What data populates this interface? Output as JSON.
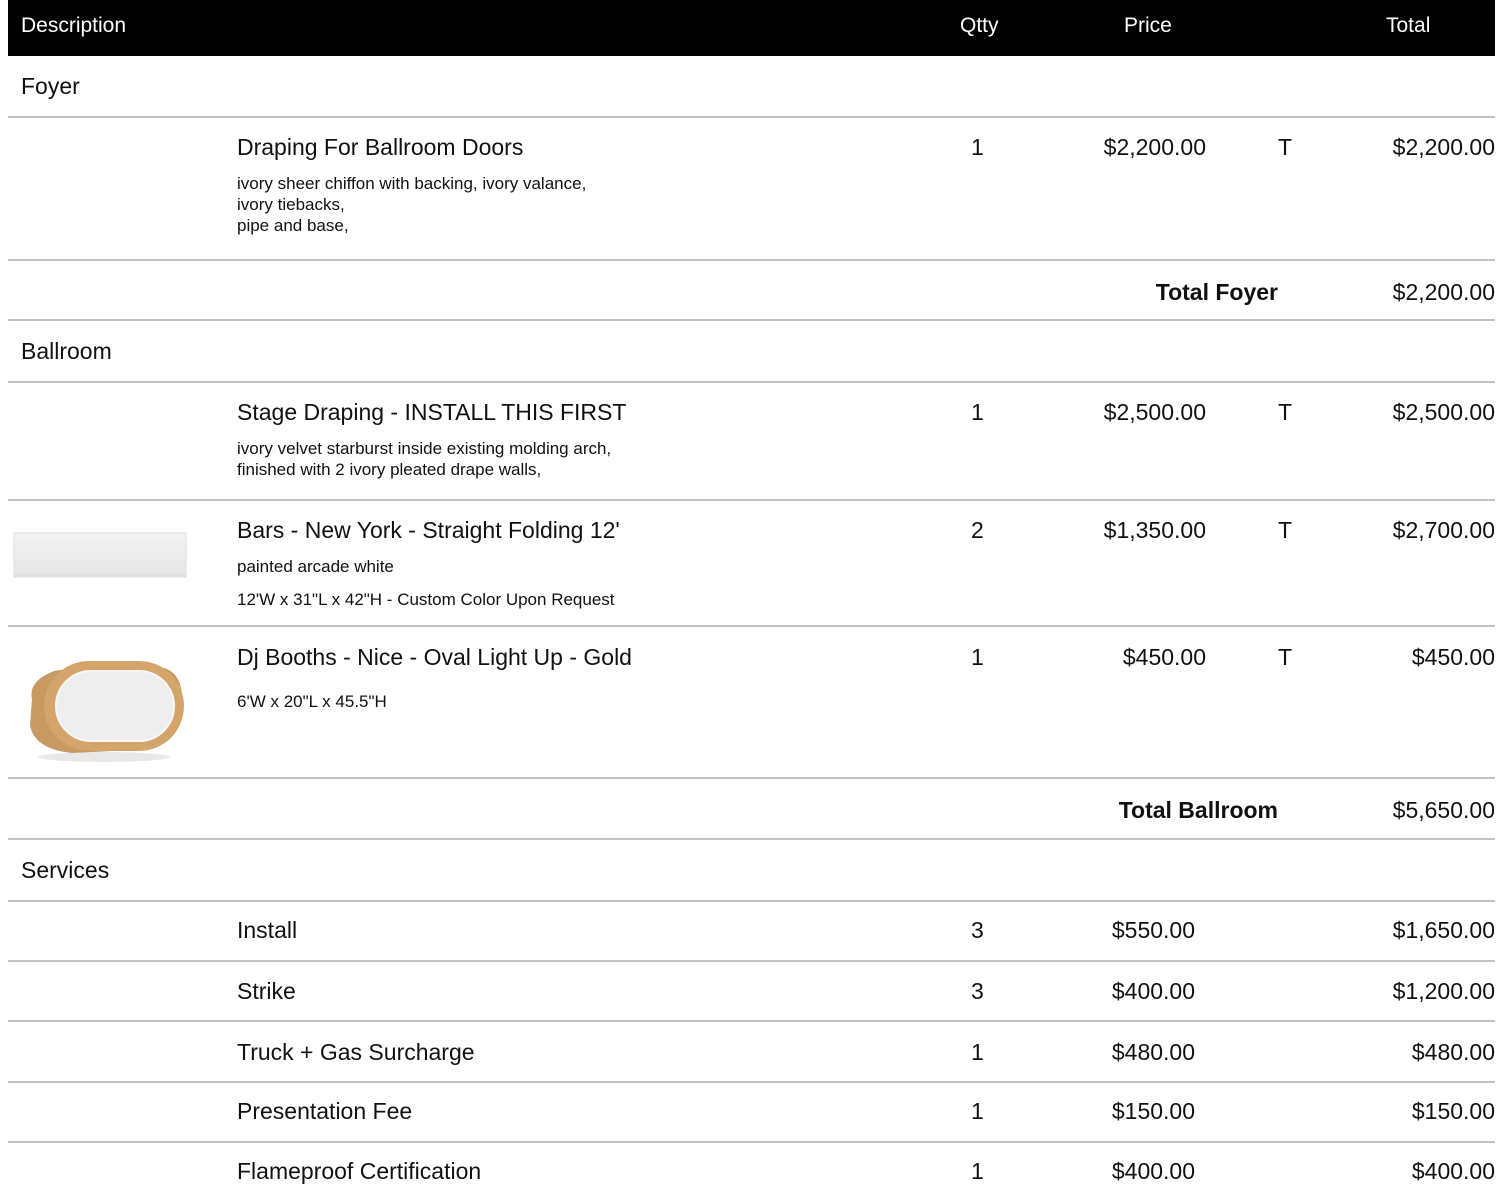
{
  "header": {
    "description": "Description",
    "qty": "Qtty",
    "price": "Price",
    "total": "Total"
  },
  "foyer": {
    "title": "Foyer",
    "items": [
      {
        "name": "Draping For Ballroom Doors",
        "desc": "ivory sheer chiffon with backing, ivory valance,\nivory tiebacks,\npipe and base,",
        "qty": "1",
        "price": "$2,200.00",
        "tax": "T",
        "total": "$2,200.00"
      }
    ],
    "total_label": "Total Foyer",
    "total_value": "$2,200.00"
  },
  "ballroom": {
    "title": "Ballroom",
    "items": [
      {
        "name": "Stage Draping - INSTALL THIS FIRST",
        "desc": "ivory velvet starburst inside existing molding arch,\nfinished with 2 ivory pleated drape walls,",
        "qty": "1",
        "price": "$2,500.00",
        "tax": "T",
        "total": "$2,500.00"
      },
      {
        "name": "Bars - New York - Straight Folding 12'",
        "desc1": "painted arcade white",
        "desc2": "12'W x 31\"L x 42\"H - Custom Color Upon Request",
        "qty": "2",
        "price": "$1,350.00",
        "tax": "T",
        "total": "$2,700.00",
        "image": "white-folding-bar-image"
      },
      {
        "name": "Dj Booths - Nice - Oval Light Up - Gold",
        "desc": "6'W x 20\"L x 45.5\"H",
        "qty": "1",
        "price": "$450.00",
        "tax": "T",
        "total": "$450.00",
        "image": "gold-oval-dj-booth-image"
      }
    ],
    "total_label": "Total Ballroom",
    "total_value": "$5,650.00"
  },
  "services": {
    "title": "Services",
    "items": [
      {
        "name": "Install",
        "qty": "3",
        "price": "$550.00",
        "total": "$1,650.00"
      },
      {
        "name": "Strike",
        "qty": "3",
        "price": "$400.00",
        "total": "$1,200.00"
      },
      {
        "name": "Truck + Gas Surcharge",
        "qty": "1",
        "price": "$480.00",
        "total": "$480.00"
      },
      {
        "name": "Presentation Fee",
        "qty": "1",
        "price": "$150.00",
        "total": "$150.00"
      },
      {
        "name": "Flameproof Certification",
        "qty": "1",
        "price": "$400.00",
        "total": "$400.00"
      }
    ]
  },
  "colors": {
    "header_bg": "#000000",
    "header_text": "#ffffff",
    "divider": "#c2c2c2",
    "booth_gold": "#d4a56a"
  }
}
